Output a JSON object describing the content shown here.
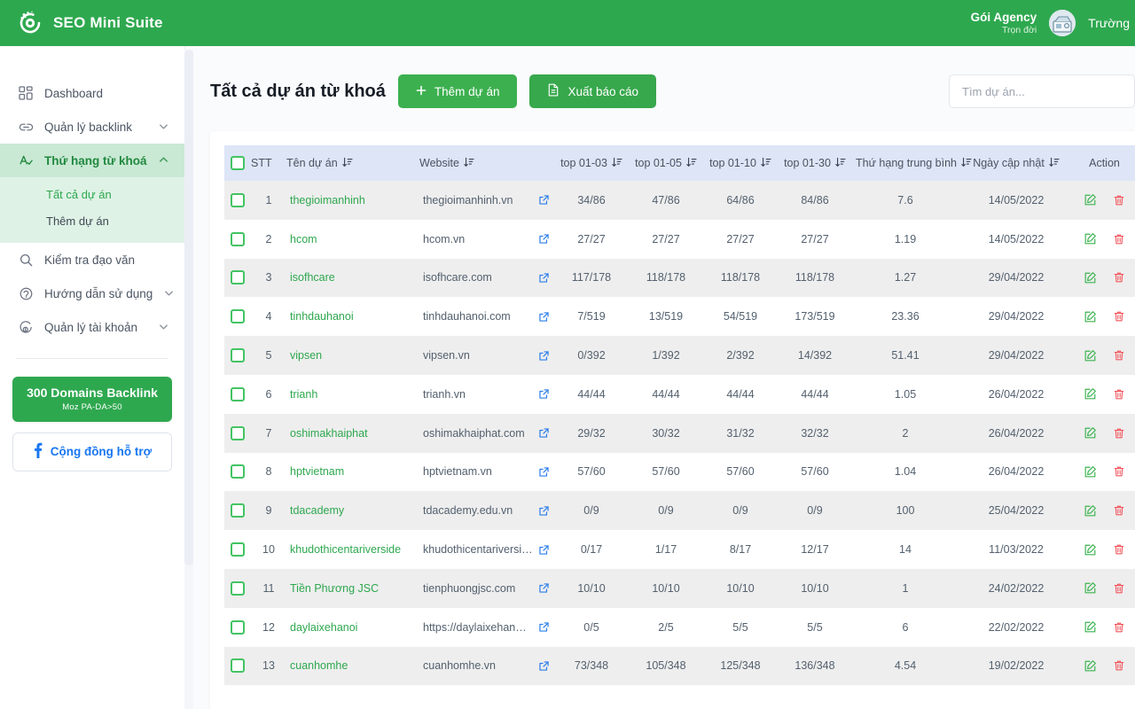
{
  "header": {
    "brand": "SEO Mini Suite",
    "logo_icon": "seo-logo-icon",
    "plan_title": "Gói Agency",
    "plan_sub": "Trọn đời",
    "user_name": "Trường",
    "avatar_icon": "user-avatar",
    "brand_color": "#2EA84F"
  },
  "sidebar": {
    "items": [
      {
        "label": "Dashboard",
        "icon": "grid-icon",
        "has_chevron": false,
        "active": false
      },
      {
        "label": "Quản lý backlink",
        "icon": "link-icon",
        "has_chevron": true,
        "active": false
      },
      {
        "label": "Thứ hạng từ khoá",
        "icon": "keyword-rank-icon",
        "has_chevron": true,
        "active": true
      },
      {
        "label": "Kiểm tra đạo văn",
        "icon": "search-icon",
        "has_chevron": false,
        "active": false
      },
      {
        "label": "Hướng dẫn sử dụng",
        "icon": "help-icon",
        "has_chevron": true,
        "active": false
      },
      {
        "label": "Quản lý tài khoản",
        "icon": "account-icon",
        "has_chevron": true,
        "active": false
      }
    ],
    "submenu": [
      {
        "label": "Tất cả dự án",
        "active": true
      },
      {
        "label": "Thêm dự án",
        "active": false
      }
    ],
    "promo": {
      "title": "300 Domains Backlink",
      "subtitle": "Moz PA-DA>50",
      "color": "#2EA84F"
    },
    "support": {
      "label": "Cộng đồng hỗ trợ",
      "icon": "facebook-icon",
      "color": "#1877F2"
    }
  },
  "main": {
    "title": "Tất cả dự án từ khoá",
    "add_button": {
      "label": "Thêm dự án",
      "icon": "plus-icon"
    },
    "export_button": {
      "label": "Xuất báo cáo",
      "icon": "file-export-icon"
    },
    "search": {
      "placeholder": "Tìm dự án...",
      "value": ""
    }
  },
  "table": {
    "sort_icon": "sort-descending-icon",
    "edit_icon": "edit-icon",
    "delete_icon": "trash-icon",
    "external_link_icon": "external-link-icon",
    "columns": [
      {
        "key": "checkbox",
        "label": ""
      },
      {
        "key": "stt",
        "label": "STT",
        "sortable": false
      },
      {
        "key": "name",
        "label": "Tên dự án",
        "sortable": true
      },
      {
        "key": "website",
        "label": "Website",
        "sortable": true
      },
      {
        "key": "top0103",
        "label": "top 01-03",
        "sortable": true
      },
      {
        "key": "top0105",
        "label": "top 01-05",
        "sortable": true
      },
      {
        "key": "top0110",
        "label": "top 01-10",
        "sortable": true
      },
      {
        "key": "top0130",
        "label": "top 01-30",
        "sortable": true
      },
      {
        "key": "avg",
        "label": "Thứ hạng trung bình",
        "sortable": true
      },
      {
        "key": "updated",
        "label": "Ngày cập nhật",
        "sortable": true
      },
      {
        "key": "action",
        "label": "Action",
        "sortable": false
      }
    ],
    "rows": [
      {
        "stt": "1",
        "name": "thegioimanhinh",
        "website": "thegioimanhinh.vn",
        "top0103": "34/86",
        "top0105": "47/86",
        "top0110": "64/86",
        "top0130": "84/86",
        "avg": "7.6",
        "updated": "14/05/2022"
      },
      {
        "stt": "2",
        "name": "hcom",
        "website": "hcom.vn",
        "top0103": "27/27",
        "top0105": "27/27",
        "top0110": "27/27",
        "top0130": "27/27",
        "avg": "1.19",
        "updated": "14/05/2022"
      },
      {
        "stt": "3",
        "name": "isofhcare",
        "website": "isofhcare.com",
        "top0103": "117/178",
        "top0105": "118/178",
        "top0110": "118/178",
        "top0130": "118/178",
        "avg": "1.27",
        "updated": "29/04/2022"
      },
      {
        "stt": "4",
        "name": "tinhdauhanoi",
        "website": "tinhdauhanoi.com",
        "top0103": "7/519",
        "top0105": "13/519",
        "top0110": "54/519",
        "top0130": "173/519",
        "avg": "23.36",
        "updated": "29/04/2022"
      },
      {
        "stt": "5",
        "name": "vipsen",
        "website": "vipsen.vn",
        "top0103": "0/392",
        "top0105": "1/392",
        "top0110": "2/392",
        "top0130": "14/392",
        "avg": "51.41",
        "updated": "29/04/2022"
      },
      {
        "stt": "6",
        "name": "trianh",
        "website": "trianh.vn",
        "top0103": "44/44",
        "top0105": "44/44",
        "top0110": "44/44",
        "top0130": "44/44",
        "avg": "1.05",
        "updated": "26/04/2022"
      },
      {
        "stt": "7",
        "name": "oshimakhaiphat",
        "website": "oshimakhaiphat.com",
        "top0103": "29/32",
        "top0105": "30/32",
        "top0110": "31/32",
        "top0130": "32/32",
        "avg": "2",
        "updated": "26/04/2022"
      },
      {
        "stt": "8",
        "name": "hptvietnam",
        "website": "hptvietnam.vn",
        "top0103": "57/60",
        "top0105": "57/60",
        "top0110": "57/60",
        "top0130": "57/60",
        "avg": "1.04",
        "updated": "26/04/2022"
      },
      {
        "stt": "9",
        "name": "tdacademy",
        "website": "tdacademy.edu.vn",
        "top0103": "0/9",
        "top0105": "0/9",
        "top0110": "0/9",
        "top0130": "0/9",
        "avg": "100",
        "updated": "25/04/2022"
      },
      {
        "stt": "10",
        "name": "khudothicentariverside",
        "website": "khudothicentariverside....",
        "top0103": "0/17",
        "top0105": "1/17",
        "top0110": "8/17",
        "top0130": "12/17",
        "avg": "14",
        "updated": "11/03/2022"
      },
      {
        "stt": "11",
        "name": "Tiền Phương JSC",
        "website": "tienphuongjsc.com",
        "top0103": "10/10",
        "top0105": "10/10",
        "top0110": "10/10",
        "top0130": "10/10",
        "avg": "1",
        "updated": "24/02/2022"
      },
      {
        "stt": "12",
        "name": "daylaixehanoi",
        "website": "https://daylaixehanoi.vn/",
        "top0103": "0/5",
        "top0105": "2/5",
        "top0110": "5/5",
        "top0130": "5/5",
        "avg": "6",
        "updated": "22/02/2022"
      },
      {
        "stt": "13",
        "name": "cuanhomhe",
        "website": "cuanhomhe.vn",
        "top0103": "73/348",
        "top0105": "105/348",
        "top0110": "125/348",
        "top0130": "136/348",
        "avg": "4.54",
        "updated": "19/02/2022"
      }
    ]
  }
}
